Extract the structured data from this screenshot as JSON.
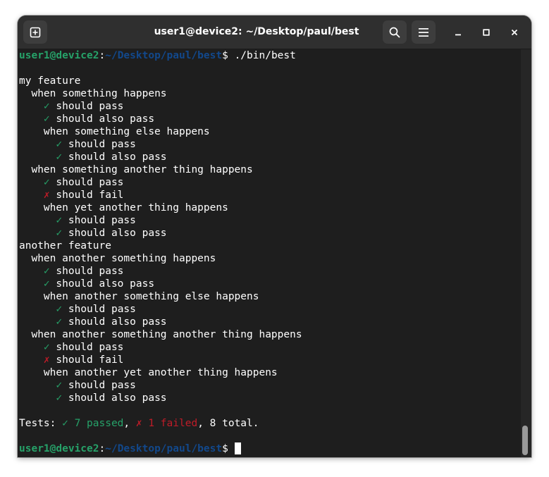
{
  "window": {
    "title": "user1@device2: ~/Desktop/paul/best",
    "new_tab_icon": "new-tab-icon",
    "search_icon": "search-icon",
    "menu_icon": "hamburger-menu-icon",
    "minimize_icon": "minimize-icon",
    "maximize_icon": "maximize-icon",
    "close_icon": "close-icon"
  },
  "colors": {
    "pass": "#26a269",
    "fail": "#c01c28",
    "prompt_user": "#26a269",
    "prompt_path": "#12488b",
    "background": "#1e1e1e"
  },
  "prompt": {
    "user_host": "user1@device2",
    "separator": ":",
    "path": "~/Desktop/paul/best",
    "symbol": "$",
    "command": " ./bin/best"
  },
  "output": {
    "lines": [
      {
        "indent": "",
        "mark": "",
        "status": "",
        "text": "my feature"
      },
      {
        "indent": "  ",
        "mark": "",
        "status": "",
        "text": "when something happens"
      },
      {
        "indent": "    ",
        "mark": "✓",
        "status": "pass",
        "text": " should pass"
      },
      {
        "indent": "    ",
        "mark": "✓",
        "status": "pass",
        "text": " should also pass"
      },
      {
        "indent": "    ",
        "mark": "",
        "status": "",
        "text": "when something else happens"
      },
      {
        "indent": "      ",
        "mark": "✓",
        "status": "pass",
        "text": " should pass"
      },
      {
        "indent": "      ",
        "mark": "✓",
        "status": "pass",
        "text": " should also pass"
      },
      {
        "indent": "  ",
        "mark": "",
        "status": "",
        "text": "when something another thing happens"
      },
      {
        "indent": "    ",
        "mark": "✓",
        "status": "pass",
        "text": " should pass"
      },
      {
        "indent": "    ",
        "mark": "✗",
        "status": "fail",
        "text": " should fail"
      },
      {
        "indent": "    ",
        "mark": "",
        "status": "",
        "text": "when yet another thing happens"
      },
      {
        "indent": "      ",
        "mark": "✓",
        "status": "pass",
        "text": " should pass"
      },
      {
        "indent": "      ",
        "mark": "✓",
        "status": "pass",
        "text": " should also pass"
      },
      {
        "indent": "",
        "mark": "",
        "status": "",
        "text": "another feature"
      },
      {
        "indent": "  ",
        "mark": "",
        "status": "",
        "text": "when another something happens"
      },
      {
        "indent": "    ",
        "mark": "✓",
        "status": "pass",
        "text": " should pass"
      },
      {
        "indent": "    ",
        "mark": "✓",
        "status": "pass",
        "text": " should also pass"
      },
      {
        "indent": "    ",
        "mark": "",
        "status": "",
        "text": "when another something else happens"
      },
      {
        "indent": "      ",
        "mark": "✓",
        "status": "pass",
        "text": " should pass"
      },
      {
        "indent": "      ",
        "mark": "✓",
        "status": "pass",
        "text": " should also pass"
      },
      {
        "indent": "  ",
        "mark": "",
        "status": "",
        "text": "when another something another thing happens"
      },
      {
        "indent": "    ",
        "mark": "✓",
        "status": "pass",
        "text": " should pass"
      },
      {
        "indent": "    ",
        "mark": "✗",
        "status": "fail",
        "text": " should fail"
      },
      {
        "indent": "    ",
        "mark": "",
        "status": "",
        "text": "when another yet another thing happens"
      },
      {
        "indent": "      ",
        "mark": "✓",
        "status": "pass",
        "text": " should pass"
      },
      {
        "indent": "      ",
        "mark": "✓",
        "status": "pass",
        "text": " should also pass"
      }
    ]
  },
  "summary": {
    "label": "Tests: ",
    "passed": "✓ 7 passed",
    "sep1": ", ",
    "failed": "✗ 1 failed",
    "rest": ", 8 total."
  }
}
